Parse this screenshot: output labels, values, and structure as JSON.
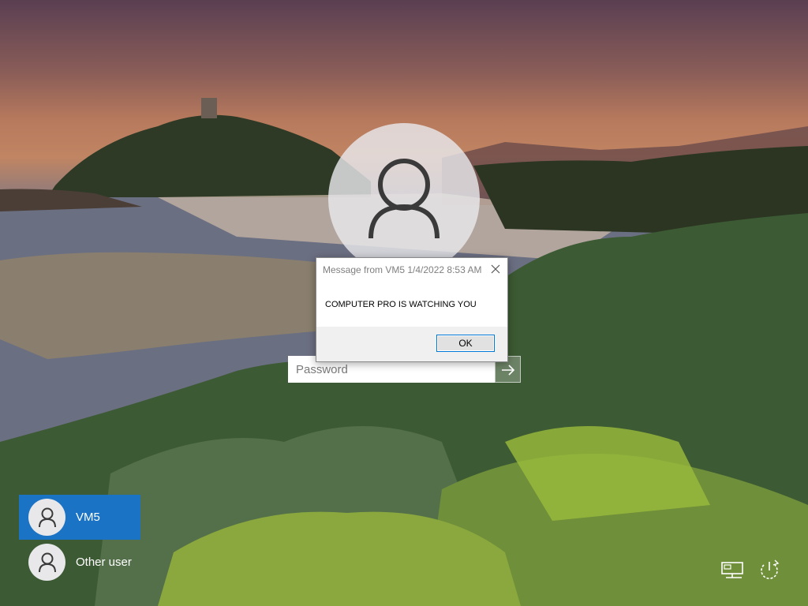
{
  "user": {
    "avatar_icon": "user-icon"
  },
  "password": {
    "placeholder": "Password",
    "submit_icon": "arrow-right-icon"
  },
  "message_box": {
    "title": "Message from VM5 1/4/2022 8:53 AM",
    "text": "COMPUTER PRO IS WATCHING YOU",
    "ok_label": "OK",
    "close_icon": "close-icon"
  },
  "users": [
    {
      "label": "VM5",
      "selected": true
    },
    {
      "label": "Other user",
      "selected": false
    }
  ],
  "system_icons": [
    "network-icon",
    "power-icon"
  ],
  "colors": {
    "selected_user": "#1a73c4",
    "ok_border": "#0078d7"
  }
}
